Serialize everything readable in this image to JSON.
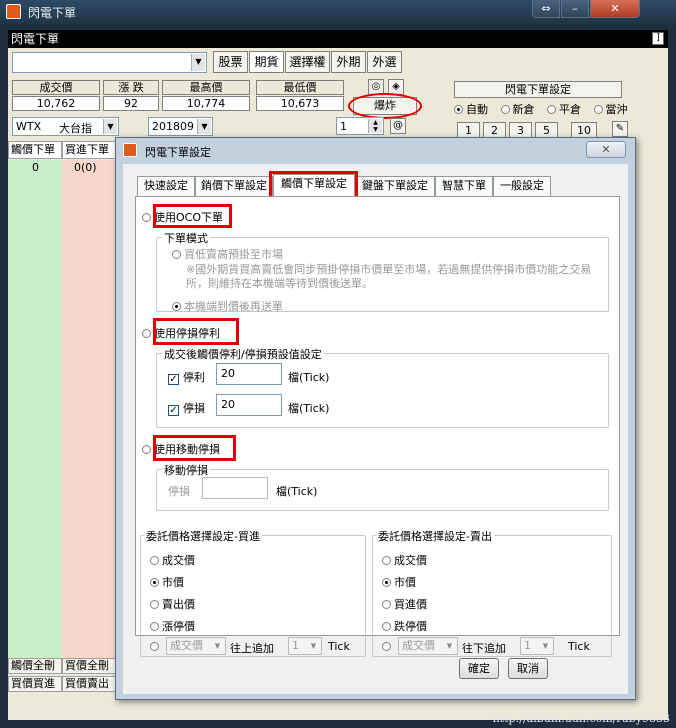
{
  "main": {
    "title": "閃電下單",
    "panel_title": "閃電下單",
    "pin_glyph": "]",
    "win_controls": {
      "restore": "⇔",
      "minimize": "–",
      "close": "✕"
    },
    "toolbar": {
      "stock": "股票",
      "futures": "期貨",
      "options": "選擇權",
      "foreign_futures": "外期",
      "foreign_options": "外選"
    },
    "quote_headers": [
      "成交價",
      "漲 跌",
      "最高價",
      "最低價"
    ],
    "quote_values": [
      "10,762",
      "92",
      "10,774",
      "10,673"
    ],
    "burst_label": "爆炸",
    "symbol": {
      "code": "WTX",
      "name": "大台指",
      "month": "201809"
    },
    "qty": "1",
    "right_panel": {
      "title": "閃電下單設定",
      "radios": [
        {
          "label": "自動",
          "on": true
        },
        {
          "label": "新倉",
          "on": false
        },
        {
          "label": "平倉",
          "on": false
        },
        {
          "label": "當沖",
          "on": false
        }
      ],
      "qty_buttons": [
        "1",
        "2",
        "3",
        "5",
        "10"
      ]
    },
    "grid": {
      "col1_header": "觸價下單",
      "col2_header": "買進下單",
      "col1_value": "0",
      "col2_value": "0(0)"
    },
    "bottom": {
      "cancel_touch": "觸價全刪",
      "cancel_buy": "買價全刪",
      "buy_buy": "買價買進",
      "buy_sell": "買價賣出"
    }
  },
  "dialog": {
    "title": "閃電下單設定",
    "close_glyph": "✕",
    "tabs": [
      "快速設定",
      "銷價下單設定",
      "觸價下單設定",
      "鍵盤下單設定",
      "智慧下單",
      "一般設定"
    ],
    "active_tab": 2,
    "oco": {
      "label": "使用OCO下單",
      "mode_group": "下單模式",
      "opt1": "買低賣高預掛至市場",
      "note": "※國外期貨買高賣低會同步預掛停損市價單至市場，若過無提供停損市價功能之交易所，則維持在本機端等待到價後送單。",
      "opt2": "本機端到價後再送單"
    },
    "stop": {
      "label": "使用停損停利",
      "group": "成交後觸價停利/停損預設值設定",
      "profit_label": "停利",
      "profit_value": "20",
      "loss_label": "停損",
      "loss_value": "20",
      "unit": "檔(Tick)"
    },
    "trail": {
      "label": "使用移動停損",
      "group": "移動停損",
      "loss_label": "停損",
      "unit": "檔(Tick)"
    },
    "buy_price": {
      "group": "委託價格選擇設定-買進",
      "options": [
        {
          "label": "成交價",
          "on": false
        },
        {
          "label": "市價",
          "on": true
        },
        {
          "label": "賣出價",
          "on": false
        },
        {
          "label": "漲停價",
          "on": false
        }
      ],
      "combo": "成交價",
      "add_label": "往上追加",
      "add_value": "1",
      "tick": "Tick"
    },
    "sell_price": {
      "group": "委託價格選擇設定-賣出",
      "options": [
        {
          "label": "成交價",
          "on": false
        },
        {
          "label": "市價",
          "on": true
        },
        {
          "label": "買進價",
          "on": false
        },
        {
          "label": "跌停價",
          "on": false
        }
      ],
      "combo": "成交價",
      "add_label": "往下追加",
      "add_value": "1",
      "tick": "Tick"
    },
    "ok": "確定",
    "cancel": "取消"
  },
  "watermark": "http://album.udn.com/ruby9833",
  "colors": {
    "highlight_red": "#e00000",
    "green_col": "#c8f0c8",
    "pink_col": "#f8d8cc"
  }
}
